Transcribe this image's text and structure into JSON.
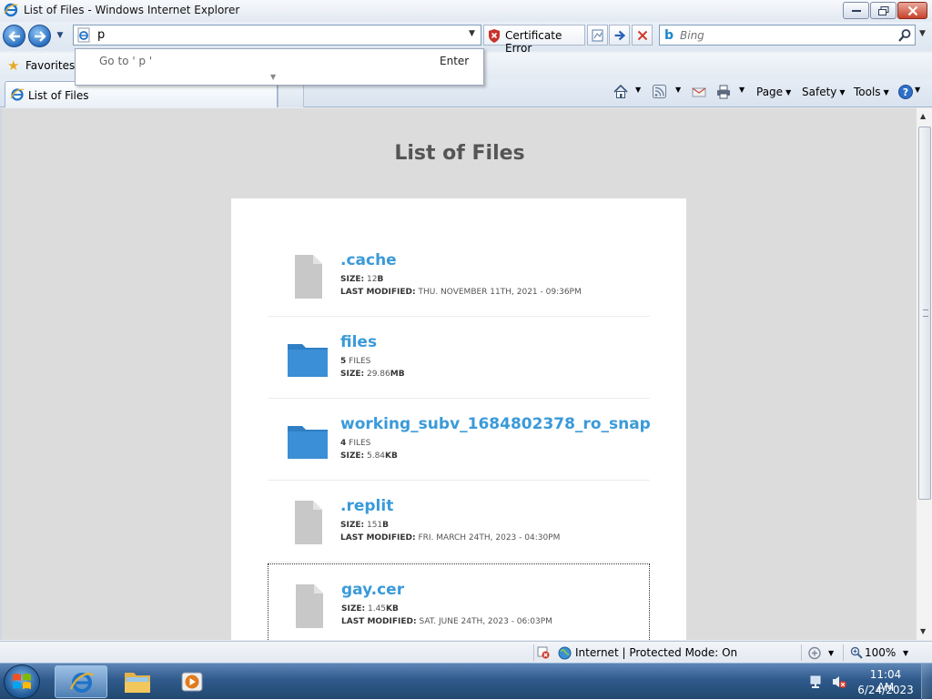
{
  "window": {
    "title": "List of Files - Windows Internet Explorer"
  },
  "navigation": {
    "address_value": "p",
    "certificate_label": "Certificate Error",
    "search_placeholder": "Bing"
  },
  "autocomplete": {
    "goto_text": "Go to ' p '",
    "enter_label": "Enter"
  },
  "favorites_bar": {
    "favorites_label": "Favorites"
  },
  "tabs": [
    {
      "label": "List of Files",
      "active": true
    }
  ],
  "command_bar": {
    "page_label": "Page",
    "safety_label": "Safety",
    "tools_label": "Tools"
  },
  "page": {
    "title": "List of Files",
    "entries": [
      {
        "name": ".cache",
        "type": "file",
        "line1_key": "SIZE:",
        "line1_value": "12",
        "line1_unit": "B",
        "line2_key": "LAST MODIFIED:",
        "line2_value": "THU. NOVEMBER 11TH, 2021 - 09:36PM"
      },
      {
        "name": "files",
        "type": "folder",
        "line1_key": "5",
        "line1_value": "FILES",
        "line1_unit": "",
        "line2_key": "SIZE:",
        "line2_value": "29.86",
        "line2_unit": "MB"
      },
      {
        "name": "working_subv_1684802378_ro_snap",
        "type": "folder",
        "line1_key": "4",
        "line1_value": "FILES",
        "line1_unit": "",
        "line2_key": "SIZE:",
        "line2_value": "5.84",
        "line2_unit": "KB"
      },
      {
        "name": ".replit",
        "type": "file",
        "line1_key": "SIZE:",
        "line1_value": "151",
        "line1_unit": "B",
        "line2_key": "LAST MODIFIED:",
        "line2_value": "FRI. MARCH 24TH, 2023 - 04:30PM"
      },
      {
        "name": "gay.cer",
        "type": "file",
        "line1_key": "SIZE:",
        "line1_value": "1.45",
        "line1_unit": "KB",
        "line2_key": "LAST MODIFIED:",
        "line2_value": "SAT. JUNE 24TH, 2023 - 06:03PM"
      }
    ]
  },
  "status_bar": {
    "zone_text": "Internet | Protected Mode: On",
    "zoom": "100%"
  },
  "taskbar": {
    "time": "11:04 AM",
    "date": "6/24/2023"
  },
  "colors": {
    "link_blue": "#3a9ad9",
    "folder_blue": "#3a8fd6",
    "file_gray": "#c8c8c8",
    "page_bg": "#dcdcdc"
  }
}
